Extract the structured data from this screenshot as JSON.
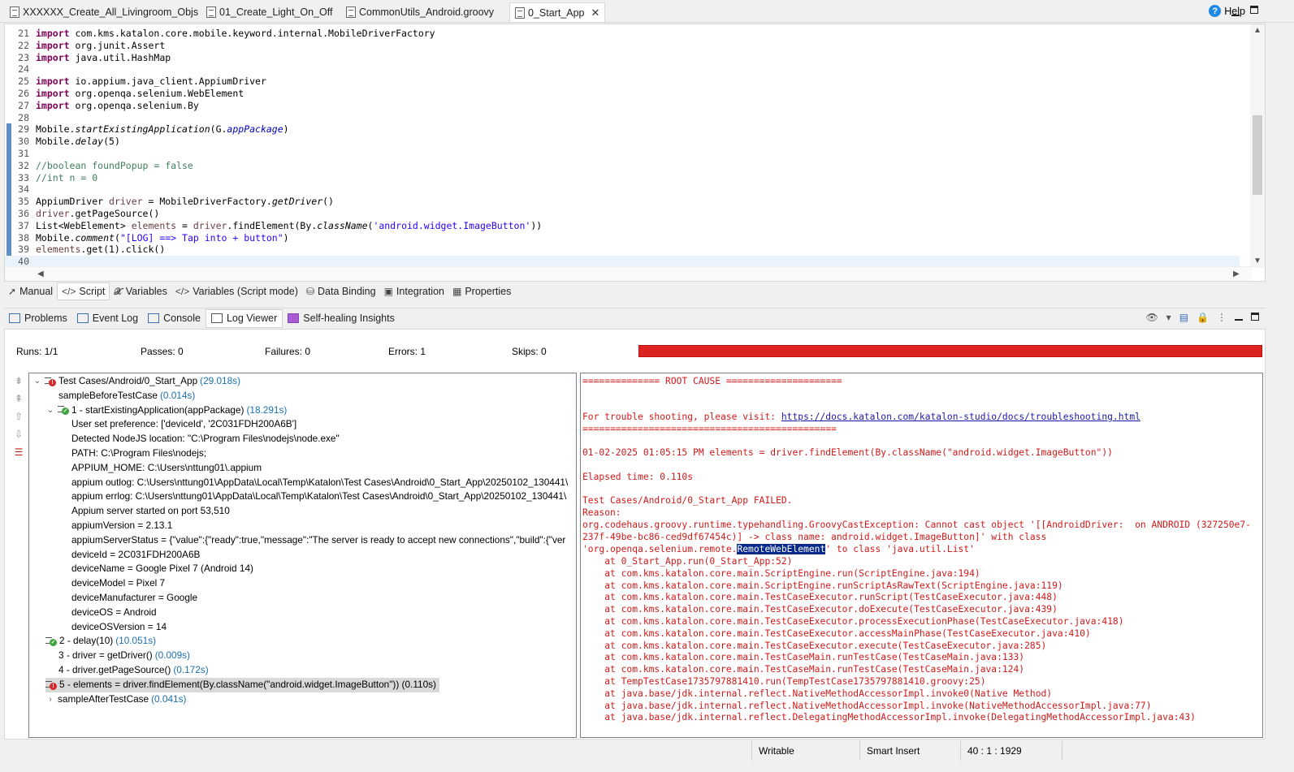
{
  "editor_tabs_top": [
    {
      "label": "XXXXXX_Create_All_Livingroom_Objs",
      "active": false
    },
    {
      "label": "01_Create_Light_On_Off",
      "active": false
    },
    {
      "label": "CommonUtils_Android.groovy",
      "active": false
    },
    {
      "label": "0_Start_App",
      "active": true
    }
  ],
  "help_label": "Help",
  "code_lines": [
    {
      "n": "21",
      "parts": [
        [
          "kw",
          "import"
        ],
        [
          "",
          "com.kms.katalon.core.mobile.keyword.internal.MobileDriverFactory"
        ]
      ]
    },
    {
      "n": "22",
      "parts": [
        [
          "kw",
          "import"
        ],
        [
          "",
          "org.junit.Assert"
        ]
      ]
    },
    {
      "n": "23",
      "parts": [
        [
          "kw",
          "import"
        ],
        [
          "",
          "java.util.HashMap"
        ]
      ]
    },
    {
      "n": "24",
      "parts": []
    },
    {
      "n": "25",
      "parts": [
        [
          "kw",
          "import"
        ],
        [
          "",
          "io.appium.java_client.AppiumDriver"
        ]
      ]
    },
    {
      "n": "26",
      "parts": [
        [
          "kw",
          "import"
        ],
        [
          "",
          "org.openqa.selenium.WebElement"
        ]
      ]
    },
    {
      "n": "27",
      "parts": [
        [
          "kw",
          "import"
        ],
        [
          "",
          "org.openqa.selenium.By"
        ]
      ]
    },
    {
      "n": "28",
      "parts": []
    },
    {
      "n": "29",
      "parts": [
        [
          "",
          "Mobile."
        ],
        [
          "ital",
          "startExistingApplication"
        ],
        [
          "",
          "(G."
        ],
        [
          "fld",
          "appPackage"
        ],
        [
          "",
          ")"
        ]
      ]
    },
    {
      "n": "30",
      "parts": [
        [
          "",
          "Mobile."
        ],
        [
          "ital",
          "delay"
        ],
        [
          "",
          "(5)"
        ]
      ]
    },
    {
      "n": "31",
      "parts": []
    },
    {
      "n": "32",
      "parts": [
        [
          "cmt",
          "//boolean foundPopup = false"
        ]
      ]
    },
    {
      "n": "33",
      "parts": [
        [
          "cmt",
          "//int n = 0"
        ]
      ]
    },
    {
      "n": "34",
      "parts": []
    },
    {
      "n": "35",
      "parts": [
        [
          "",
          "AppiumDriver "
        ],
        [
          "var",
          "driver"
        ],
        [
          "",
          " = MobileDriverFactory."
        ],
        [
          "ital",
          "getDriver"
        ],
        [
          "",
          "()"
        ]
      ]
    },
    {
      "n": "36",
      "parts": [
        [
          "var",
          "driver"
        ],
        [
          "",
          ".getPageSource()"
        ]
      ]
    },
    {
      "n": "37",
      "parts": [
        [
          "",
          "List<WebElement> "
        ],
        [
          "var",
          "elements"
        ],
        [
          "",
          " = "
        ],
        [
          "var",
          "driver"
        ],
        [
          "",
          ".findElement(By."
        ],
        [
          "ital",
          "className"
        ],
        [
          "",
          "("
        ],
        [
          "str",
          "'android.widget.ImageButton'"
        ],
        [
          "",
          "))"
        ]
      ]
    },
    {
      "n": "38",
      "parts": [
        [
          "",
          "Mobile."
        ],
        [
          "ital",
          "comment"
        ],
        [
          "",
          "("
        ],
        [
          "str",
          "\"[LOG] ==> Tap into + button\""
        ],
        [
          "",
          ")"
        ]
      ]
    },
    {
      "n": "39",
      "parts": [
        [
          "var",
          "elements"
        ],
        [
          "",
          ".get(1).click()"
        ]
      ]
    },
    {
      "n": "40",
      "parts": []
    }
  ],
  "script_tabs": [
    {
      "label": "Manual",
      "icon": "cursor-icon",
      "active": false
    },
    {
      "label": "Script",
      "icon": "code-icon",
      "active": true
    },
    {
      "label": "Variables",
      "icon": "variable-icon",
      "active": false
    },
    {
      "label": "Variables (Script mode)",
      "icon": "code-icon",
      "active": false
    },
    {
      "label": "Data Binding",
      "icon": "database-icon",
      "active": false
    },
    {
      "label": "Integration",
      "icon": "integration-icon",
      "active": false
    },
    {
      "label": "Properties",
      "icon": "table-icon",
      "active": false
    }
  ],
  "panel_tabs": [
    {
      "label": "Problems",
      "active": false
    },
    {
      "label": "Event Log",
      "active": false
    },
    {
      "label": "Console",
      "active": false
    },
    {
      "label": "Log Viewer",
      "active": true
    },
    {
      "label": "Self-healing Insights",
      "active": false
    }
  ],
  "stats": {
    "runs": "Runs: 1/1",
    "passes": "Passes: 0",
    "failures": "Failures: 0",
    "errors": "Errors: 1",
    "skips": "Skips: 0",
    "progress_color": "#dd2222"
  },
  "tree": [
    {
      "indent": 0,
      "chev": "v",
      "icon": "err",
      "text": "Test Cases/Android/0_Start_App",
      "time": "(29.018s)"
    },
    {
      "indent": 2,
      "chev": "",
      "icon": "",
      "text": "sampleBeforeTestCase",
      "time": "(0.014s)"
    },
    {
      "indent": 1,
      "chev": "v",
      "icon": "ok",
      "text": "1 - startExistingApplication(appPackage)",
      "time": "(18.291s)"
    },
    {
      "indent": 3,
      "chev": "",
      "icon": "",
      "text": "User set preference: ['deviceId', '2C031FDH200A6B']",
      "time": ""
    },
    {
      "indent": 3,
      "chev": "",
      "icon": "",
      "text": "Detected NodeJS location: \"C:\\Program Files\\nodejs\\node.exe\"",
      "time": ""
    },
    {
      "indent": 3,
      "chev": "",
      "icon": "",
      "text": "PATH: C:\\Program Files\\nodejs;",
      "time": ""
    },
    {
      "indent": 3,
      "chev": "",
      "icon": "",
      "text": "APPIUM_HOME: C:\\Users\\nttung01\\.appium",
      "time": ""
    },
    {
      "indent": 3,
      "chev": "",
      "icon": "",
      "text": "appium outlog: C:\\Users\\nttung01\\AppData\\Local\\Temp\\Katalon\\Test Cases\\Android\\0_Start_App\\20250102_130441\\",
      "time": ""
    },
    {
      "indent": 3,
      "chev": "",
      "icon": "",
      "text": "appium errlog: C:\\Users\\nttung01\\AppData\\Local\\Temp\\Katalon\\Test Cases\\Android\\0_Start_App\\20250102_130441\\",
      "time": ""
    },
    {
      "indent": 3,
      "chev": "",
      "icon": "",
      "text": "Appium server started on port 53,510",
      "time": ""
    },
    {
      "indent": 3,
      "chev": "",
      "icon": "",
      "text": "appiumVersion = 2.13.1",
      "time": ""
    },
    {
      "indent": 3,
      "chev": "",
      "icon": "",
      "text": "appiumServerStatus = {\"value\":{\"ready\":true,\"message\":\"The server is ready to accept new connections\",\"build\":{\"ver",
      "time": ""
    },
    {
      "indent": 3,
      "chev": "",
      "icon": "",
      "text": "deviceId = 2C031FDH200A6B",
      "time": ""
    },
    {
      "indent": 3,
      "chev": "",
      "icon": "",
      "text": "deviceName = Google Pixel 7 (Android 14)",
      "time": ""
    },
    {
      "indent": 3,
      "chev": "",
      "icon": "",
      "text": "deviceModel = Pixel 7",
      "time": ""
    },
    {
      "indent": 3,
      "chev": "",
      "icon": "",
      "text": "deviceManufacturer = Google",
      "time": ""
    },
    {
      "indent": 3,
      "chev": "",
      "icon": "",
      "text": "deviceOS = Android",
      "time": ""
    },
    {
      "indent": 3,
      "chev": "",
      "icon": "",
      "text": "deviceOSVersion = 14",
      "time": ""
    },
    {
      "indent": 1,
      "chev": "",
      "icon": "ok",
      "text": "2 - delay(10)",
      "time": "(10.051s)"
    },
    {
      "indent": 2,
      "chev": "",
      "icon": "",
      "text": "3 - driver = getDriver()",
      "time": "(0.009s)"
    },
    {
      "indent": 2,
      "chev": "",
      "icon": "",
      "text": "4 - driver.getPageSource()",
      "time": "(0.172s)"
    },
    {
      "indent": 1,
      "chev": "",
      "icon": "err",
      "text": "5 - elements = driver.findElement(By.className(\"android.widget.ImageButton\")) (0.110s)",
      "time": "",
      "selected": true
    },
    {
      "indent": 1,
      "chev": ">",
      "icon": "",
      "text": "sampleAfterTestCase",
      "time": "(0.041s)"
    }
  ],
  "trace": {
    "l1": "============== ROOT CAUSE =====================",
    "l2": "",
    "l3a": "For trouble shooting, please visit: ",
    "l3link": "https://docs.katalon.com/katalon-studio/docs/troubleshooting.html",
    "l4": "==============================================",
    "l5": "",
    "l6": "01-02-2025 01:05:15 PM elements = driver.findElement(By.className(\"android.widget.ImageButton\"))",
    "l7": "",
    "l8": "Elapsed time: 0.110s",
    "l9": "",
    "l10": "Test Cases/Android/0_Start_App FAILED.",
    "l11": "Reason:",
    "l12": "org.codehaus.groovy.runtime.typehandling.GroovyCastException: Cannot cast object '[[AndroidDriver:  on ANDROID (327250e7-",
    "l13": "237f-49be-bc86-ced9df67454c)] -> class name: android.widget.ImageButton]' with class",
    "l14a": "'org.openqa.selenium.remote.",
    "l14hl": "RemoteWebElement",
    "l14b": "' to class 'java.util.List'",
    "stack": [
      "    at 0_Start_App.run(0_Start_App:52)",
      "    at com.kms.katalon.core.main.ScriptEngine.run(ScriptEngine.java:194)",
      "    at com.kms.katalon.core.main.ScriptEngine.runScriptAsRawText(ScriptEngine.java:119)",
      "    at com.kms.katalon.core.main.TestCaseExecutor.runScript(TestCaseExecutor.java:448)",
      "    at com.kms.katalon.core.main.TestCaseExecutor.doExecute(TestCaseExecutor.java:439)",
      "    at com.kms.katalon.core.main.TestCaseExecutor.processExecutionPhase(TestCaseExecutor.java:418)",
      "    at com.kms.katalon.core.main.TestCaseExecutor.accessMainPhase(TestCaseExecutor.java:410)",
      "    at com.kms.katalon.core.main.TestCaseExecutor.execute(TestCaseExecutor.java:285)",
      "    at com.kms.katalon.core.main.TestCaseMain.runTestCase(TestCaseMain.java:133)",
      "    at com.kms.katalon.core.main.TestCaseMain.runTestCase(TestCaseMain.java:124)",
      "    at TempTestCase1735797881410.run(TempTestCase1735797881410.groovy:25)",
      "    at java.base/jdk.internal.reflect.NativeMethodAccessorImpl.invoke0(Native Method)",
      "    at java.base/jdk.internal.reflect.NativeMethodAccessorImpl.invoke(NativeMethodAccessorImpl.java:77)",
      "    at java.base/jdk.internal.reflect.DelegatingMethodAccessorImpl.invoke(DelegatingMethodAccessorImpl.java:43)"
    ]
  },
  "statusbar": {
    "writable": "Writable",
    "insert_mode": "Smart Insert",
    "position": "40 : 1 : 1929"
  }
}
